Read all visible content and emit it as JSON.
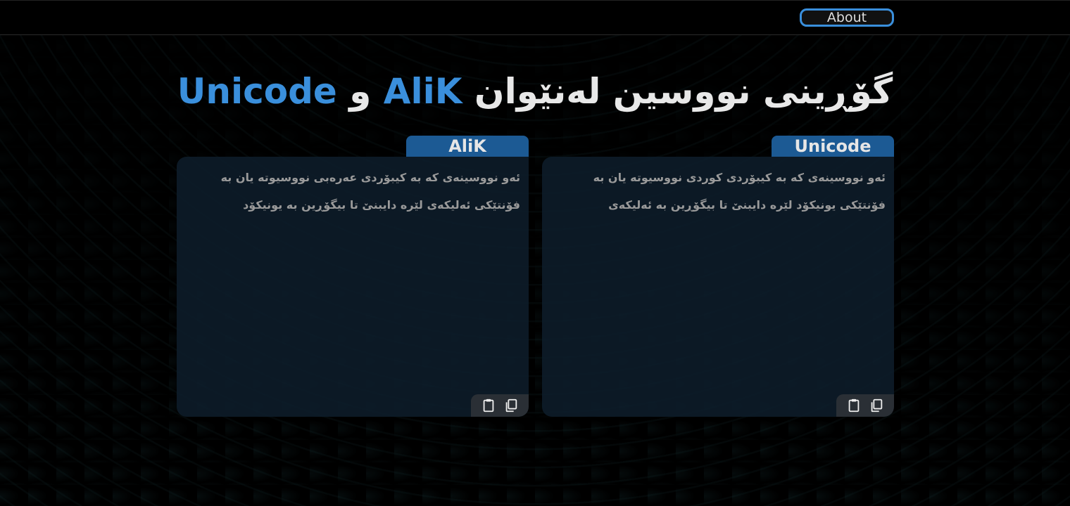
{
  "header": {
    "about_label": "About"
  },
  "title": {
    "prefix": "گۆڕینی نووسین لەنێوان",
    "alik": "AliK",
    "connector": "و",
    "unicode": "Unicode"
  },
  "panels": {
    "alik": {
      "tab_label": "AliK",
      "placeholder": "ئەو نووسینەی کە بە کیبۆردی عەرەبی نووسیوتە یان بە فۆنتێکی ئەلیکەی لێرە دایبنێ تا بیگۆڕین بە یونیکۆد"
    },
    "unicode": {
      "tab_label": "Unicode",
      "placeholder": "ئەو نووسینەی کە بە کیبۆردی کوردی نووسیوتە یان بە فۆنتێکی یونیکۆد لێرە دایبنێ تا بیگۆڕین بە ئەلیکەی"
    }
  },
  "icons": {
    "paste": "clipboard-icon",
    "copy": "copy-icon"
  },
  "colors": {
    "accent": "#3a8fdc",
    "tab_bg": "#1c5a94",
    "background": "#000000"
  }
}
